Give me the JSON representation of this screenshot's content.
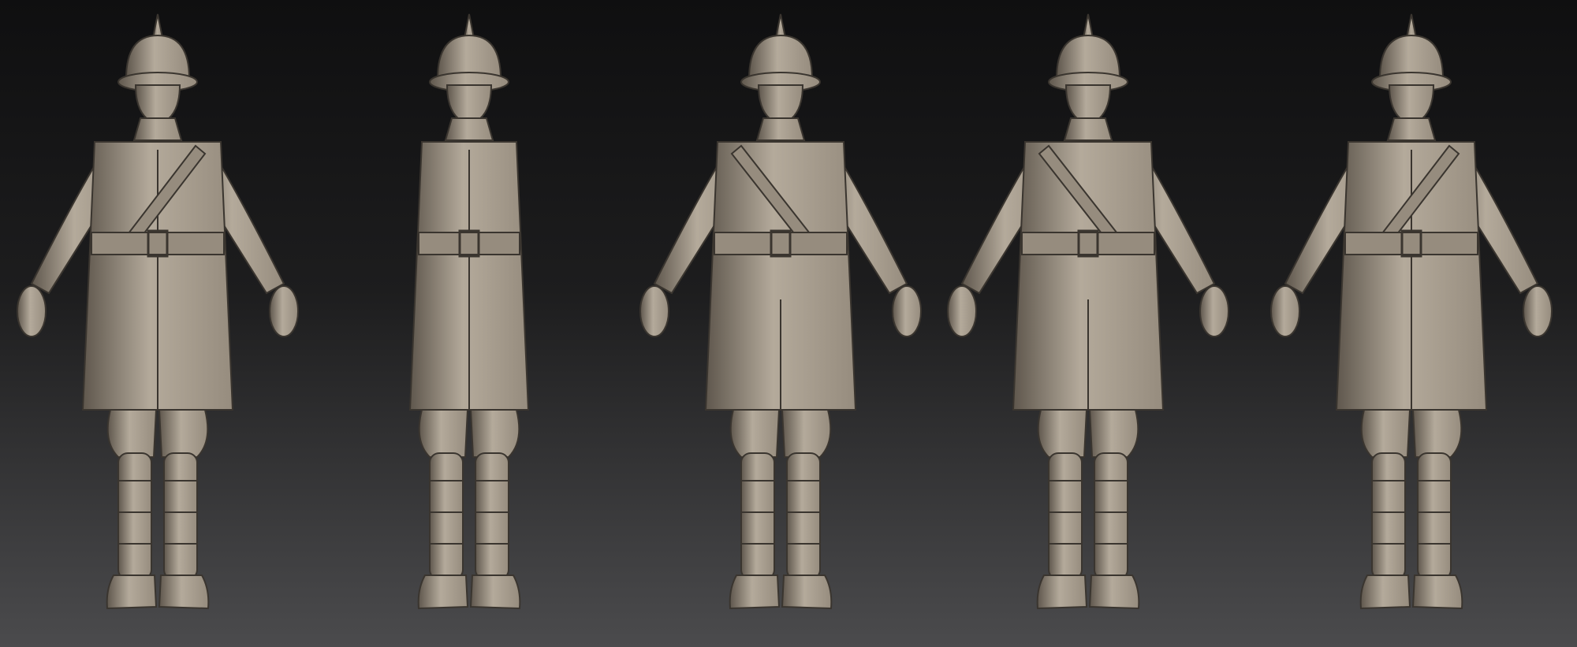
{
  "scene": {
    "colors": {
      "background_top": "#0f0f10",
      "background_bottom": "#4b4b4d",
      "clay_light": "#b4aa9b",
      "clay_mid": "#968c7e",
      "clay_dark": "#5f574d",
      "clay_shadow": "#3a352f"
    },
    "views": [
      {
        "view": "front",
        "icon": "soldier-figure-icon"
      },
      {
        "view": "side-right",
        "icon": "soldier-figure-icon"
      },
      {
        "view": "back",
        "icon": "soldier-figure-icon"
      },
      {
        "view": "back-three-quarter",
        "icon": "soldier-figure-icon"
      },
      {
        "view": "front-three-quarter",
        "icon": "soldier-figure-icon"
      }
    ]
  }
}
